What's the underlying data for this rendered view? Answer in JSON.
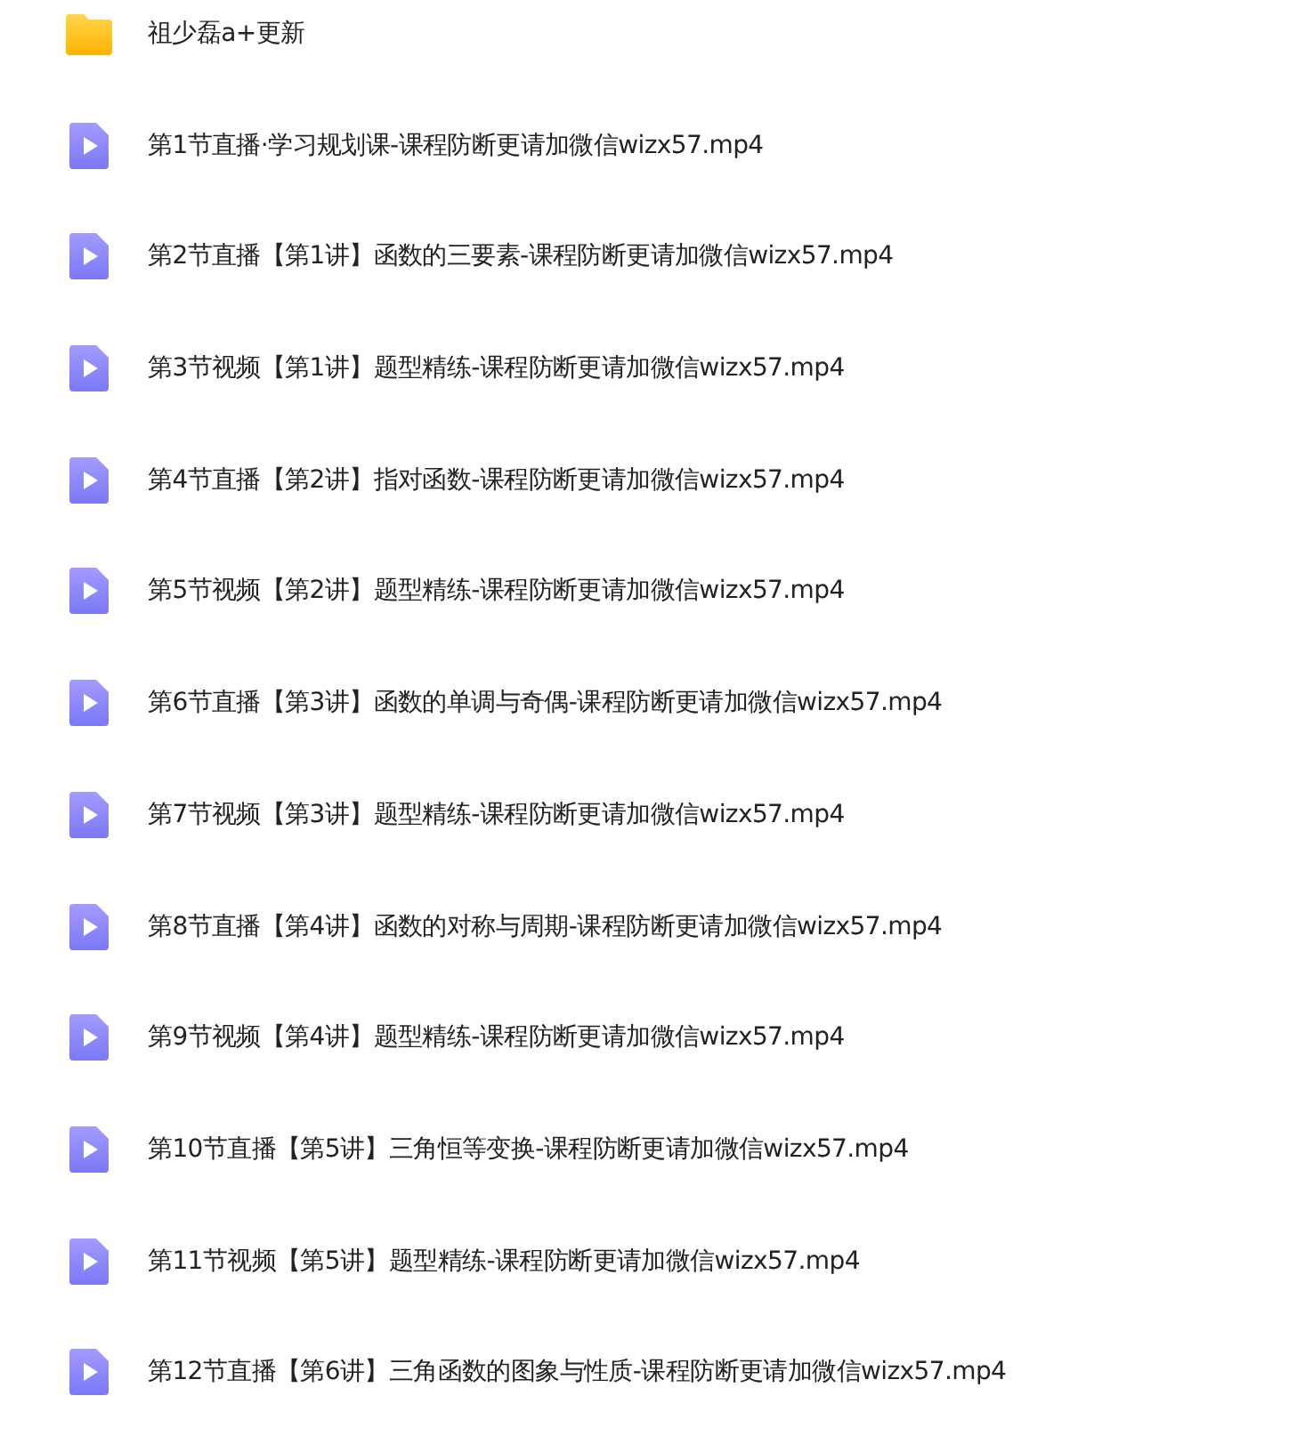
{
  "files": [
    {
      "kind": "folder",
      "name": "祖少磊a+更新"
    },
    {
      "kind": "video",
      "name": "第1节直播·学习规划课-课程防断更请加微信wizx57.mp4"
    },
    {
      "kind": "video",
      "name": "第2节直播【第1讲】函数的三要素-课程防断更请加微信wizx57.mp4"
    },
    {
      "kind": "video",
      "name": "第3节视频【第1讲】题型精练-课程防断更请加微信wizx57.mp4"
    },
    {
      "kind": "video",
      "name": "第4节直播【第2讲】指对函数-课程防断更请加微信wizx57.mp4"
    },
    {
      "kind": "video",
      "name": "第5节视频【第2讲】题型精练-课程防断更请加微信wizx57.mp4"
    },
    {
      "kind": "video",
      "name": "第6节直播【第3讲】函数的单调与奇偶-课程防断更请加微信wizx57.mp4"
    },
    {
      "kind": "video",
      "name": "第7节视频【第3讲】题型精练-课程防断更请加微信wizx57.mp4"
    },
    {
      "kind": "video",
      "name": "第8节直播【第4讲】函数的对称与周期-课程防断更请加微信wizx57.mp4"
    },
    {
      "kind": "video",
      "name": "第9节视频【第4讲】题型精练-课程防断更请加微信wizx57.mp4"
    },
    {
      "kind": "video",
      "name": "第10节直播【第5讲】三角恒等变换-课程防断更请加微信wizx57.mp4"
    },
    {
      "kind": "video",
      "name": "第11节视频【第5讲】题型精练-课程防断更请加微信wizx57.mp4"
    },
    {
      "kind": "video",
      "name": "第12节直播【第6讲】三角函数的图象与性质-课程防断更请加微信wizx57.mp4"
    }
  ]
}
